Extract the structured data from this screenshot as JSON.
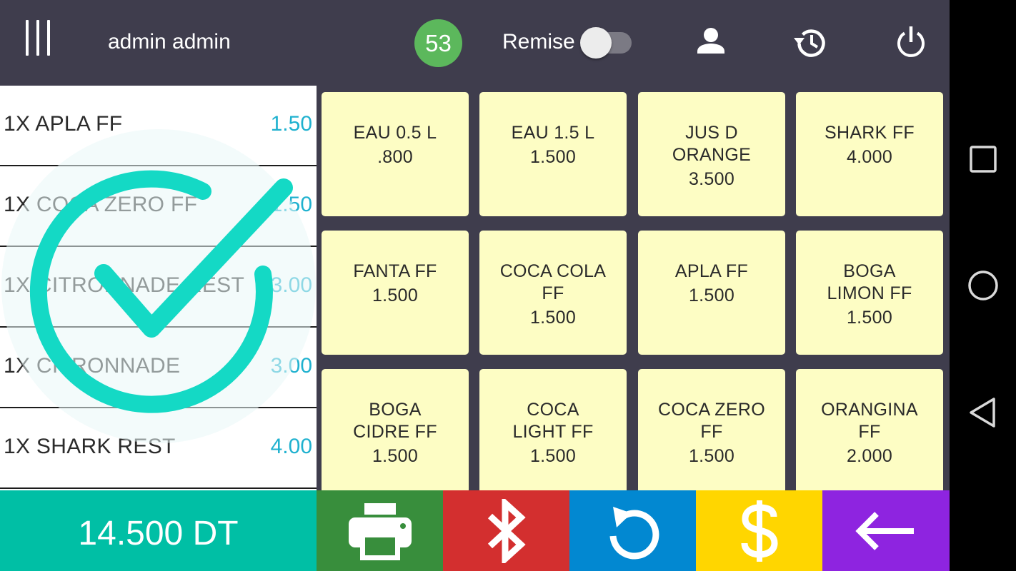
{
  "header": {
    "user_name": "admin admin",
    "order_count": "53",
    "remise_label": "Remise",
    "remise_enabled": false,
    "icons": [
      "menu-icon",
      "person-icon",
      "history-icon",
      "power-icon"
    ]
  },
  "order": {
    "items": [
      {
        "label": "1X APLA FF",
        "price": "1.50"
      },
      {
        "label": "1X COCA ZERO FF",
        "price": "1.50"
      },
      {
        "label": "1X CITRONNADE REST",
        "price": "3.00"
      },
      {
        "label": "1X CITRONNADE",
        "price": "3.00"
      },
      {
        "label": "1X SHARK REST",
        "price": "4.00"
      }
    ],
    "total": "14.500 DT",
    "overlay_icon": "checkmark-icon"
  },
  "products": [
    {
      "name": "EAU 0.5 L",
      "price": ".800"
    },
    {
      "name": "EAU 1.5 L",
      "price": "1.500"
    },
    {
      "name": "JUS D ORANGE",
      "price": "3.500"
    },
    {
      "name": "SHARK FF",
      "price": "4.000"
    },
    {
      "name": "FANTA FF",
      "price": "1.500"
    },
    {
      "name": "COCA COLA FF",
      "price": "1.500"
    },
    {
      "name": "APLA FF",
      "price": "1.500"
    },
    {
      "name": "BOGA LIMON FF",
      "price": "1.500"
    },
    {
      "name": "BOGA CIDRE FF",
      "price": "1.500"
    },
    {
      "name": "COCA LIGHT FF",
      "price": "1.500"
    },
    {
      "name": "COCA ZERO FF",
      "price": "1.500"
    },
    {
      "name": "ORANGINA FF",
      "price": "2.000"
    }
  ],
  "actions": [
    {
      "id": "print",
      "icon": "printer-icon",
      "color": "#388e3c"
    },
    {
      "id": "bluetooth",
      "icon": "bluetooth-icon",
      "color": "#d32f2f"
    },
    {
      "id": "refresh",
      "icon": "refresh-icon",
      "color": "#0288d1"
    },
    {
      "id": "pay",
      "icon": "dollar-icon",
      "color": "#ffd600"
    },
    {
      "id": "back",
      "icon": "arrow-left-icon",
      "color": "#8e24e0"
    }
  ],
  "colors": {
    "topbar": "#3f3d4d",
    "badge": "#5cb85c",
    "price_text": "#1fb1cf",
    "total_bar": "#00bfa5",
    "product_tile": "#fdfdc4",
    "checkmark": "#14d9c5"
  },
  "system_nav": [
    "recents-icon",
    "home-icon",
    "back-icon"
  ]
}
